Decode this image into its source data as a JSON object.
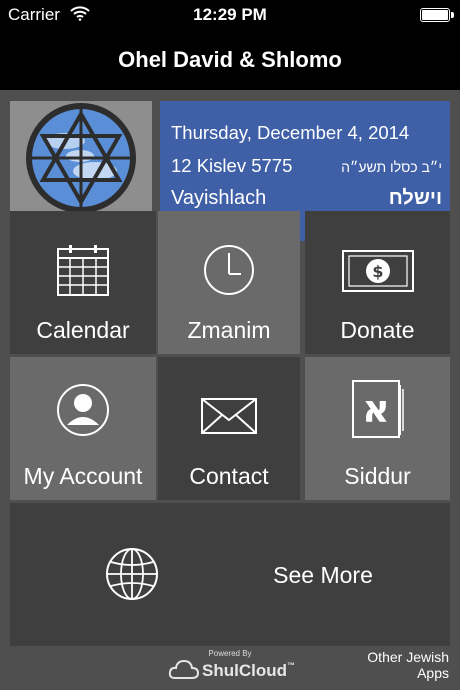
{
  "status_bar": {
    "carrier": "Carrier",
    "time": "12:29 PM"
  },
  "nav": {
    "title": "Ohel David & Shlomo"
  },
  "info": {
    "date": "Thursday, December 4, 2014",
    "hebrew_date": "12 Kislev 5775",
    "hebrew_date_he": "י״ב כסלו תשע״ה",
    "parsha": "Vayishlach",
    "parsha_he": "וישלח"
  },
  "tiles": {
    "calendar": {
      "label": "Calendar",
      "icon": "calendar-icon"
    },
    "zmanim": {
      "label": "Zmanim",
      "icon": "clock-icon"
    },
    "donate": {
      "label": "Donate",
      "icon": "dollar-bill-icon"
    },
    "account": {
      "label": "My Account",
      "icon": "user-icon"
    },
    "contact": {
      "label": "Contact",
      "icon": "envelope-icon"
    },
    "siddur": {
      "label": "Siddur",
      "icon": "aleph-book-icon"
    },
    "see_more": {
      "label": "See More",
      "icon": "globe-icon"
    }
  },
  "siddur_glyph": "א",
  "footer": {
    "powered_by": "Powered By",
    "brand": "ShulCloud",
    "brand_tm": "™",
    "other_line1": "Other Jewish",
    "other_line2": "Apps"
  }
}
